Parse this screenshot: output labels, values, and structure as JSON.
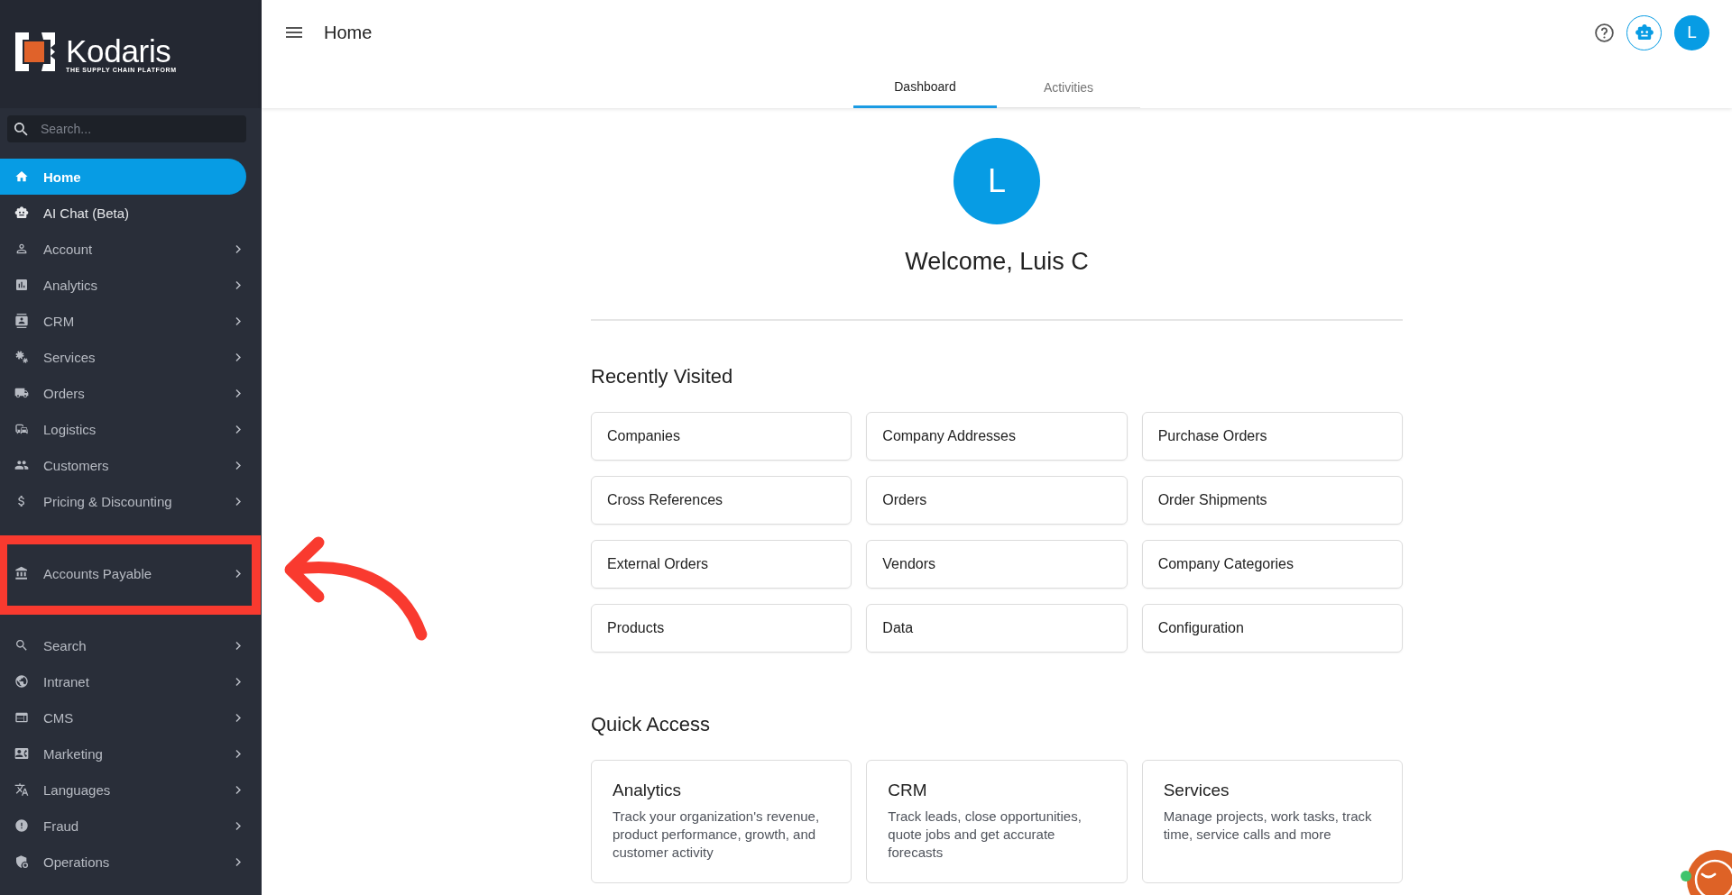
{
  "sidebar": {
    "brand": {
      "name": "Kodaris",
      "tagline": "THE SUPPLY CHAIN PLATFORM"
    },
    "search": {
      "placeholder": "Search..."
    },
    "items": [
      {
        "label": "Home",
        "kind": "link",
        "selected": true,
        "annotated": false
      },
      {
        "label": "AI Chat (Beta)",
        "kind": "link",
        "selected": false,
        "annotated": false
      },
      {
        "label": "Account",
        "kind": "group",
        "selected": false,
        "annotated": false
      },
      {
        "label": "Analytics",
        "kind": "group",
        "selected": false,
        "annotated": false
      },
      {
        "label": "CRM",
        "kind": "group",
        "selected": false,
        "annotated": false
      },
      {
        "label": "Services",
        "kind": "group",
        "selected": false,
        "annotated": false
      },
      {
        "label": "Orders",
        "kind": "group",
        "selected": false,
        "annotated": false
      },
      {
        "label": "Logistics",
        "kind": "group",
        "selected": false,
        "annotated": false
      },
      {
        "label": "Customers",
        "kind": "group",
        "selected": false,
        "annotated": false
      },
      {
        "label": "Pricing & Discounting",
        "kind": "group",
        "selected": false,
        "annotated": false
      },
      {
        "label": "Accounts Payable",
        "kind": "group",
        "selected": false,
        "annotated": true
      },
      {
        "label": "Search",
        "kind": "group",
        "selected": false,
        "annotated": false
      },
      {
        "label": "Intranet",
        "kind": "group",
        "selected": false,
        "annotated": false
      },
      {
        "label": "CMS",
        "kind": "group",
        "selected": false,
        "annotated": false
      },
      {
        "label": "Marketing",
        "kind": "group",
        "selected": false,
        "annotated": false
      },
      {
        "label": "Languages",
        "kind": "group",
        "selected": false,
        "annotated": false
      },
      {
        "label": "Fraud",
        "kind": "group",
        "selected": false,
        "annotated": false
      },
      {
        "label": "Operations",
        "kind": "group",
        "selected": false,
        "annotated": false
      }
    ]
  },
  "header": {
    "title": "Home",
    "avatar": "L"
  },
  "tabs": [
    {
      "label": "Dashboard",
      "selected": true
    },
    {
      "label": "Activities",
      "selected": false
    }
  ],
  "profile": {
    "initial": "L",
    "greeting": "Welcome, Luis C"
  },
  "recently_visited": {
    "title": "Recently Visited",
    "items": [
      "Companies",
      "Company Addresses",
      "Purchase Orders",
      "Cross References",
      "Orders",
      "Order Shipments",
      "External Orders",
      "Vendors",
      "Company Categories",
      "Products",
      "Data",
      "Configuration"
    ]
  },
  "quick_access": {
    "title": "Quick Access",
    "items": [
      {
        "title": "Analytics",
        "description": "Track your organization's revenue, product performance, growth, and customer activity"
      },
      {
        "title": "CRM",
        "description": "Track leads, close opportunities, quote jobs and get accurate forecasts"
      },
      {
        "title": "Services",
        "description": "Manage projects, work tasks, track time, service calls and more"
      }
    ]
  },
  "chat_widget": {
    "online": true
  }
}
